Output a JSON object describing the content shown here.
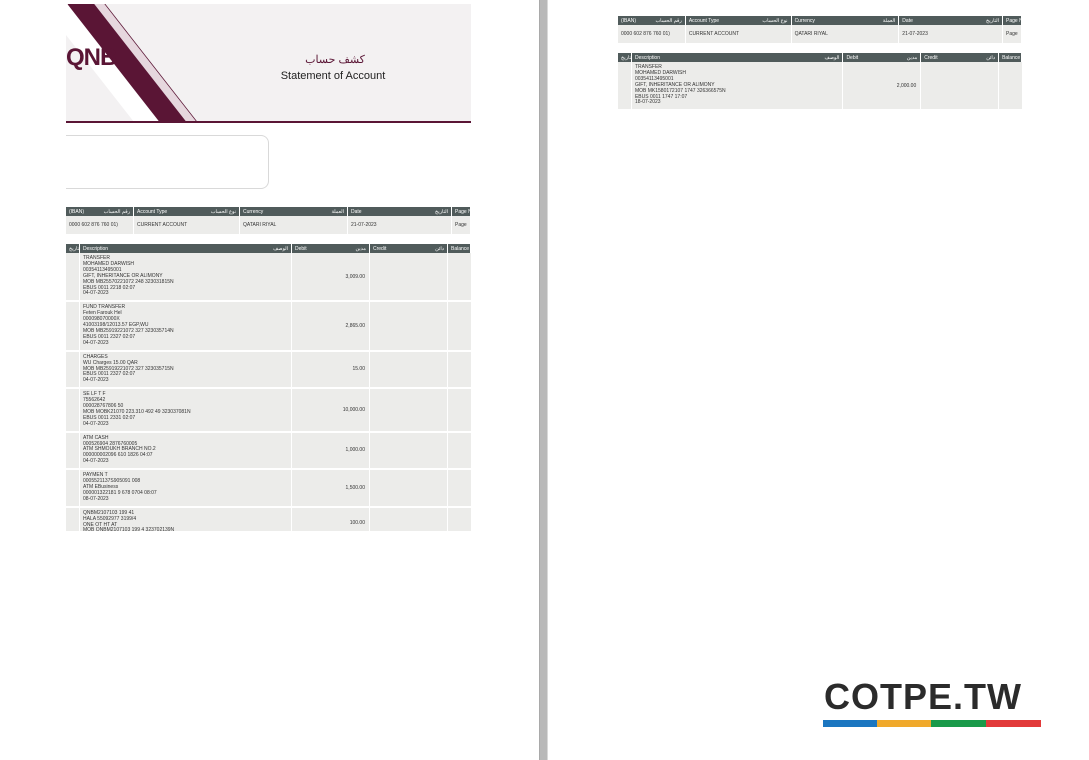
{
  "colors": {
    "brand": "#5a1535",
    "header_cell": "#505b5b",
    "cell_bg": "#ececea"
  },
  "page1": {
    "logo": "QNB",
    "title_ar": "كشف حساب",
    "title_en": "Statement  of Account",
    "summary": {
      "headers": [
        {
          "en": "(IBAN)",
          "ar": "رقم الحساب"
        },
        {
          "en": "Account Type",
          "ar": "نوع الحساب"
        },
        {
          "en": "Currency",
          "ar": "العملة"
        },
        {
          "en": "Date",
          "ar": "التاريخ"
        },
        {
          "en": "Page N",
          "ar": ""
        }
      ],
      "values": [
        "0000 602 876 760 01)",
        "CURRENT ACCOUNT",
        "QATARI  RIYAL",
        "21-07-2023",
        "Page"
      ]
    },
    "tx_headers": {
      "date": "التاريخ",
      "description": "Description",
      "description_ar": "الوصف",
      "debit": "Debit",
      "debit_ar": "مدين",
      "credit": "Credit",
      "credit_ar": "دائن",
      "balance": "Balance"
    },
    "transactions": [
      {
        "lines": [
          "TRANSFER",
          "MOHAMED   DARWISH",
          "00354113495001",
          "GIFT,  INHERITANCE    OR  ALIMONY",
          "MOB  MB25570221072 248        323031815N",
          "EBUS   0011   2218  02:07",
          "04-07-2023"
        ],
        "debit": "3,009.00",
        "credit": ""
      },
      {
        "lines": [
          "FUND TRANSFER",
          "Feten  Farouk  Hel",
          "000098070000X",
          "41003198/12013.57    EGP,WU",
          "MOB  MB25919221072 327        323035714N",
          "EBUS   0011   2327  02:07",
          "04-07-2023"
        ],
        "debit": "2,865.00",
        "credit": ""
      },
      {
        "lines": [
          "CHARGES",
          "WU  Charges   15.00  QAR",
          "MOB  MB25919221072 327        323035715N",
          "EBUS   0011   2327  02:07",
          "04-07-2023"
        ],
        "debit": "15.00",
        "credit": ""
      },
      {
        "lines": [
          "SE LF T F",
          "75562642",
          "000028767806 50",
          "MOB  MOBK21070 223.310 492 49    323037081N",
          "EBUS   0011   2331  02:07",
          "04-07-2023"
        ],
        "debit": "10,000.00",
        "credit": ""
      },
      {
        "lines": [
          "ATM   CASH",
          "000526904 2876760005",
          "ATM  SHMOUKH   BRANCH   NO.2",
          "000000002096    610   1826   04:07",
          "04-07-2023"
        ],
        "debit": "1,000.00",
        "credit": ""
      },
      {
        "lines": [
          "PAYMEN T",
          "0005521137S905091 008",
          "ATM  EBusiness",
          "000001322181 9    678  0704  08:07",
          "08-07-2023"
        ],
        "debit": "1,500.00",
        "credit": ""
      },
      {
        "lines": [
          "QNBM2107103 199 41",
          "HALA  55092977   3199/4",
          "ONE  OT HT  AT",
          "MOB  QNBM2107103 199 4        323702139N"
        ],
        "debit": "100.00",
        "credit": ""
      }
    ]
  },
  "page2": {
    "summary": {
      "headers": [
        {
          "en": "(IBAN)",
          "ar": "رقم الحساب"
        },
        {
          "en": "Account Type",
          "ar": "نوع الحساب"
        },
        {
          "en": "Currency",
          "ar": "العملة"
        },
        {
          "en": "Date",
          "ar": "التاريخ"
        },
        {
          "en": "Page N",
          "ar": ""
        }
      ],
      "values": [
        "0000 602 876 760 01)",
        "CURRENT ACCOUNT",
        "QATARI  RIYAL",
        "21-07-2023",
        "Page"
      ]
    },
    "tx_headers": {
      "date": "التاريخ",
      "description": "Description",
      "description_ar": "الوصف",
      "debit": "Debit",
      "debit_ar": "مدين",
      "credit": "Credit",
      "credit_ar": "دائن",
      "balance": "Balance"
    },
    "transactions": [
      {
        "lines": [
          "TRANSFER",
          "MOHAMED   DARWISH",
          "00354113495001",
          "GIFT,  INHERITANCE    OR  ALIMONY",
          "MOB  MK1580172107 1747        326366575N",
          "EBUS   0011   1747  17:07",
          "18-07-2023"
        ],
        "debit": "2,000.00",
        "credit": ""
      }
    ]
  },
  "watermark": {
    "text": "COTPE.TW",
    "bar_colors": [
      "#1b76c0",
      "#f0a92b",
      "#1a9a4a",
      "#e23a3a"
    ]
  }
}
